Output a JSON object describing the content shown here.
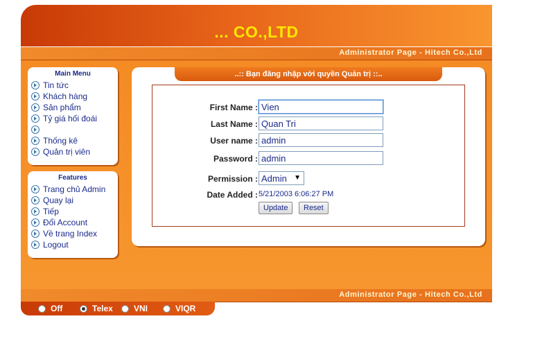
{
  "header": {
    "company": "... CO.,LTD",
    "admin_strip": "Administrator Page - Hitech Co.,Ltd"
  },
  "main_menu": {
    "title": "Main Menu",
    "items": [
      "Tin tức",
      "Khách hàng",
      "Sản phẩm",
      "Tỷ giá hối đoái",
      "",
      "Thống kê",
      "Quản trị viên"
    ]
  },
  "features": {
    "title": "Features",
    "items": [
      "Trang chủ Admin",
      "Quay lại",
      "Tiếp",
      "Đổi Account",
      "Về trang Index",
      "Logout"
    ]
  },
  "panel": {
    "title": "..:: Bạn đăng nhập với quyền Quản trị ::..",
    "first_name_label": "First Name :",
    "first_name": "Vien",
    "last_name_label": "Last Name :",
    "last_name": "Quan Tri",
    "user_name_label": "User name :",
    "user_name": "admin",
    "password_label": "Password :",
    "password": "admin",
    "permission_label": "Permission :",
    "permission": "Admin",
    "date_added_label": "Date Added :",
    "date_added": "5/21/2003 6:06:27 PM",
    "update_label": "Update",
    "reset_label": "Reset"
  },
  "footer": {
    "admin_strip": "Administrator Page - Hitech Co.,Ltd"
  },
  "input_methods": [
    {
      "label": "Off",
      "selected": false
    },
    {
      "label": "Telex",
      "selected": true
    },
    {
      "label": "VNI",
      "selected": false
    },
    {
      "label": "VIQR",
      "selected": false
    }
  ]
}
